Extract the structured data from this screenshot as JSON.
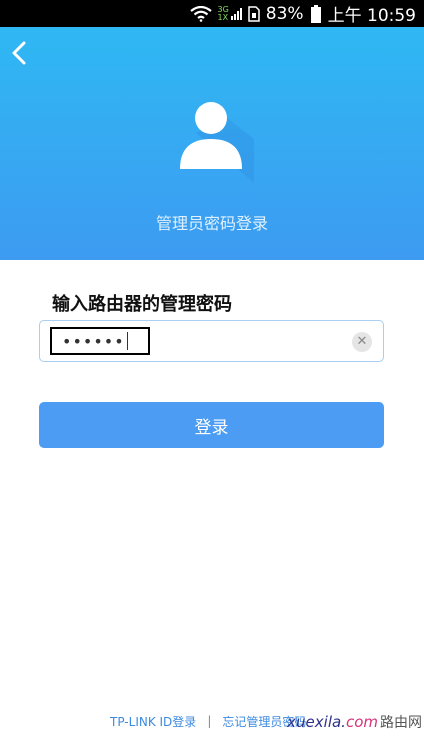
{
  "status_bar": {
    "network_top": "3G",
    "network_bottom": "1X",
    "battery": "83%",
    "time": "上午 10:59"
  },
  "header": {
    "title": "管理员密码登录"
  },
  "form": {
    "label": "输入路由器的管理密码",
    "password_value": "••••••"
  },
  "login_button": "登录",
  "footer": {
    "tplink_login": "TP-LINK ID登录",
    "separator": "|",
    "forgot_password": "忘记管理员密码"
  },
  "watermark": {
    "latin": "xuexila.",
    "com": "com",
    "cn": "路由网"
  },
  "colors": {
    "header_top": "#2fb8f3",
    "header_bottom": "#3d9bf1",
    "button": "#4b9cf2",
    "link": "#3d8be0"
  }
}
